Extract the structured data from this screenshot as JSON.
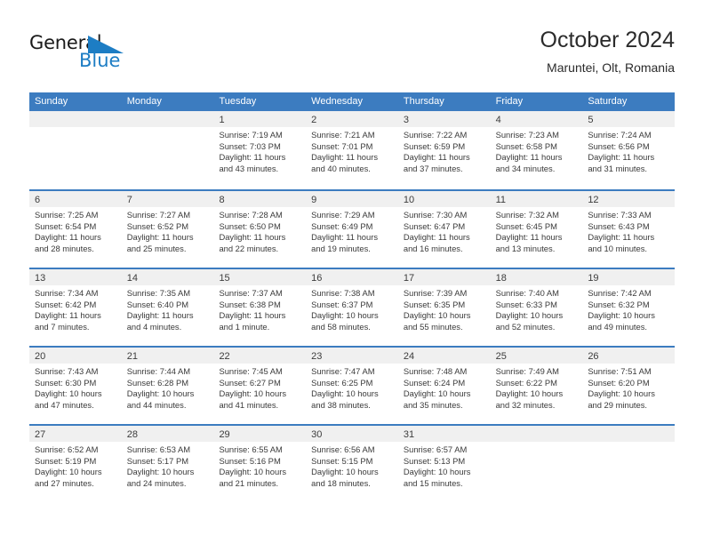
{
  "brand": {
    "name_part1": "General",
    "name_part2": "Blue",
    "triangle_color": "#1d7dc4",
    "text_color": "#1a1a1a"
  },
  "header": {
    "title": "October 2024",
    "subtitle": "Maruntei, Olt, Romania",
    "accent_color": "#3c7cc0",
    "band_color": "#f0f0f0"
  },
  "weekdays": [
    "Sunday",
    "Monday",
    "Tuesday",
    "Wednesday",
    "Thursday",
    "Friday",
    "Saturday"
  ],
  "labels": {
    "sunrise_prefix": "Sunrise:",
    "sunset_prefix": "Sunset:",
    "daylight_prefix": "Daylight:"
  },
  "weeks": [
    [
      {
        "day": "",
        "empty": true
      },
      {
        "day": "",
        "empty": true
      },
      {
        "day": "1",
        "sunrise": "Sunrise: 7:19 AM",
        "sunset": "Sunset: 7:03 PM",
        "daylight": "Daylight: 11 hours and 43 minutes."
      },
      {
        "day": "2",
        "sunrise": "Sunrise: 7:21 AM",
        "sunset": "Sunset: 7:01 PM",
        "daylight": "Daylight: 11 hours and 40 minutes."
      },
      {
        "day": "3",
        "sunrise": "Sunrise: 7:22 AM",
        "sunset": "Sunset: 6:59 PM",
        "daylight": "Daylight: 11 hours and 37 minutes."
      },
      {
        "day": "4",
        "sunrise": "Sunrise: 7:23 AM",
        "sunset": "Sunset: 6:58 PM",
        "daylight": "Daylight: 11 hours and 34 minutes."
      },
      {
        "day": "5",
        "sunrise": "Sunrise: 7:24 AM",
        "sunset": "Sunset: 6:56 PM",
        "daylight": "Daylight: 11 hours and 31 minutes."
      }
    ],
    [
      {
        "day": "6",
        "sunrise": "Sunrise: 7:25 AM",
        "sunset": "Sunset: 6:54 PM",
        "daylight": "Daylight: 11 hours and 28 minutes."
      },
      {
        "day": "7",
        "sunrise": "Sunrise: 7:27 AM",
        "sunset": "Sunset: 6:52 PM",
        "daylight": "Daylight: 11 hours and 25 minutes."
      },
      {
        "day": "8",
        "sunrise": "Sunrise: 7:28 AM",
        "sunset": "Sunset: 6:50 PM",
        "daylight": "Daylight: 11 hours and 22 minutes."
      },
      {
        "day": "9",
        "sunrise": "Sunrise: 7:29 AM",
        "sunset": "Sunset: 6:49 PM",
        "daylight": "Daylight: 11 hours and 19 minutes."
      },
      {
        "day": "10",
        "sunrise": "Sunrise: 7:30 AM",
        "sunset": "Sunset: 6:47 PM",
        "daylight": "Daylight: 11 hours and 16 minutes."
      },
      {
        "day": "11",
        "sunrise": "Sunrise: 7:32 AM",
        "sunset": "Sunset: 6:45 PM",
        "daylight": "Daylight: 11 hours and 13 minutes."
      },
      {
        "day": "12",
        "sunrise": "Sunrise: 7:33 AM",
        "sunset": "Sunset: 6:43 PM",
        "daylight": "Daylight: 11 hours and 10 minutes."
      }
    ],
    [
      {
        "day": "13",
        "sunrise": "Sunrise: 7:34 AM",
        "sunset": "Sunset: 6:42 PM",
        "daylight": "Daylight: 11 hours and 7 minutes."
      },
      {
        "day": "14",
        "sunrise": "Sunrise: 7:35 AM",
        "sunset": "Sunset: 6:40 PM",
        "daylight": "Daylight: 11 hours and 4 minutes."
      },
      {
        "day": "15",
        "sunrise": "Sunrise: 7:37 AM",
        "sunset": "Sunset: 6:38 PM",
        "daylight": "Daylight: 11 hours and 1 minute."
      },
      {
        "day": "16",
        "sunrise": "Sunrise: 7:38 AM",
        "sunset": "Sunset: 6:37 PM",
        "daylight": "Daylight: 10 hours and 58 minutes."
      },
      {
        "day": "17",
        "sunrise": "Sunrise: 7:39 AM",
        "sunset": "Sunset: 6:35 PM",
        "daylight": "Daylight: 10 hours and 55 minutes."
      },
      {
        "day": "18",
        "sunrise": "Sunrise: 7:40 AM",
        "sunset": "Sunset: 6:33 PM",
        "daylight": "Daylight: 10 hours and 52 minutes."
      },
      {
        "day": "19",
        "sunrise": "Sunrise: 7:42 AM",
        "sunset": "Sunset: 6:32 PM",
        "daylight": "Daylight: 10 hours and 49 minutes."
      }
    ],
    [
      {
        "day": "20",
        "sunrise": "Sunrise: 7:43 AM",
        "sunset": "Sunset: 6:30 PM",
        "daylight": "Daylight: 10 hours and 47 minutes."
      },
      {
        "day": "21",
        "sunrise": "Sunrise: 7:44 AM",
        "sunset": "Sunset: 6:28 PM",
        "daylight": "Daylight: 10 hours and 44 minutes."
      },
      {
        "day": "22",
        "sunrise": "Sunrise: 7:45 AM",
        "sunset": "Sunset: 6:27 PM",
        "daylight": "Daylight: 10 hours and 41 minutes."
      },
      {
        "day": "23",
        "sunrise": "Sunrise: 7:47 AM",
        "sunset": "Sunset: 6:25 PM",
        "daylight": "Daylight: 10 hours and 38 minutes."
      },
      {
        "day": "24",
        "sunrise": "Sunrise: 7:48 AM",
        "sunset": "Sunset: 6:24 PM",
        "daylight": "Daylight: 10 hours and 35 minutes."
      },
      {
        "day": "25",
        "sunrise": "Sunrise: 7:49 AM",
        "sunset": "Sunset: 6:22 PM",
        "daylight": "Daylight: 10 hours and 32 minutes."
      },
      {
        "day": "26",
        "sunrise": "Sunrise: 7:51 AM",
        "sunset": "Sunset: 6:20 PM",
        "daylight": "Daylight: 10 hours and 29 minutes."
      }
    ],
    [
      {
        "day": "27",
        "sunrise": "Sunrise: 6:52 AM",
        "sunset": "Sunset: 5:19 PM",
        "daylight": "Daylight: 10 hours and 27 minutes."
      },
      {
        "day": "28",
        "sunrise": "Sunrise: 6:53 AM",
        "sunset": "Sunset: 5:17 PM",
        "daylight": "Daylight: 10 hours and 24 minutes."
      },
      {
        "day": "29",
        "sunrise": "Sunrise: 6:55 AM",
        "sunset": "Sunset: 5:16 PM",
        "daylight": "Daylight: 10 hours and 21 minutes."
      },
      {
        "day": "30",
        "sunrise": "Sunrise: 6:56 AM",
        "sunset": "Sunset: 5:15 PM",
        "daylight": "Daylight: 10 hours and 18 minutes."
      },
      {
        "day": "31",
        "sunrise": "Sunrise: 6:57 AM",
        "sunset": "Sunset: 5:13 PM",
        "daylight": "Daylight: 10 hours and 15 minutes."
      },
      {
        "day": "",
        "empty": true
      },
      {
        "day": "",
        "empty": true
      }
    ]
  ]
}
